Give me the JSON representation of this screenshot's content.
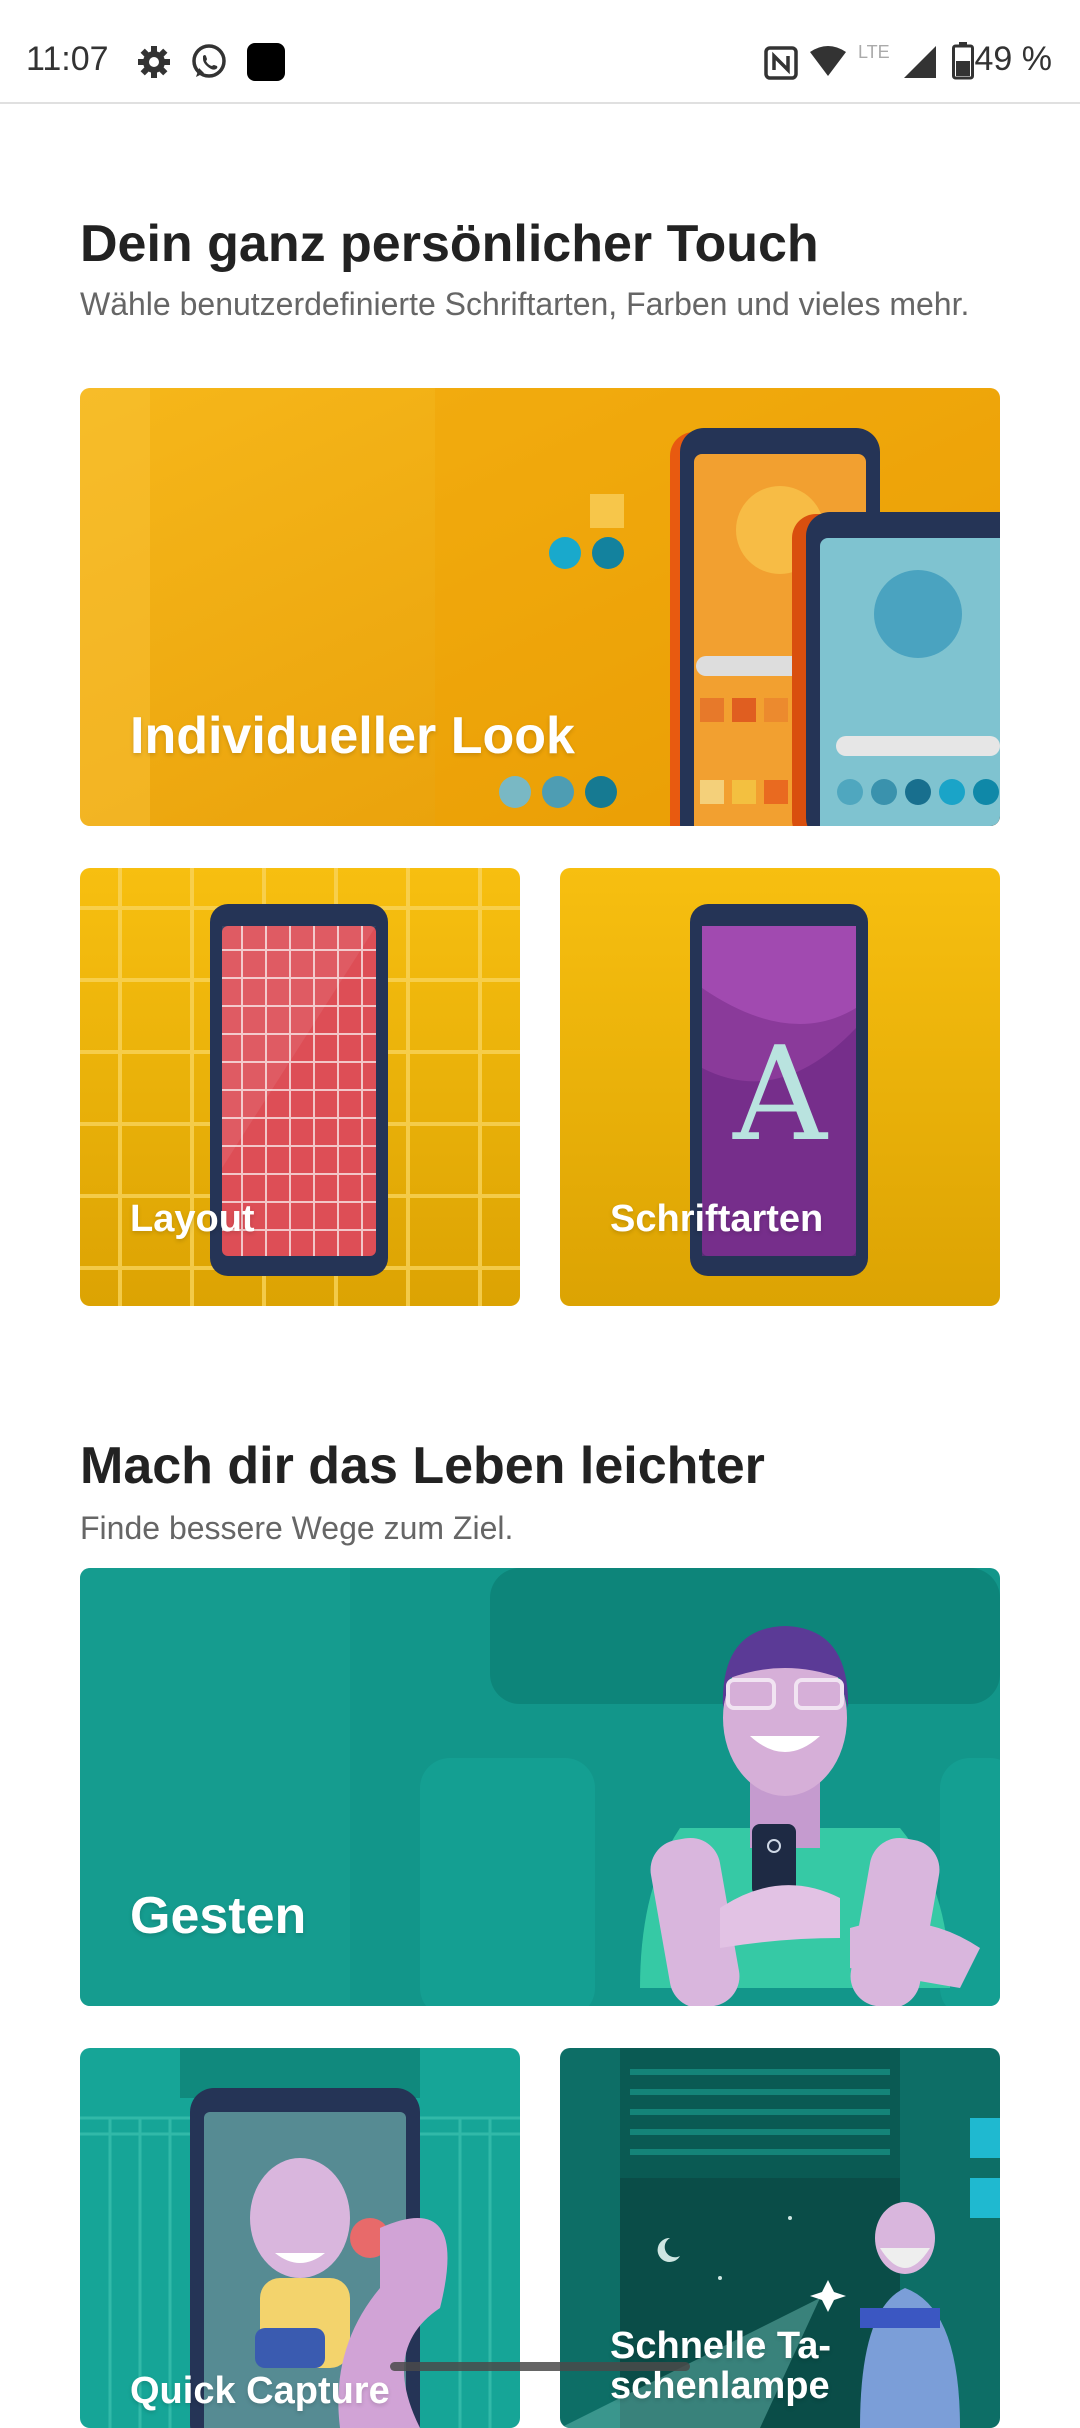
{
  "status_bar": {
    "time": "11:07",
    "network_label": "LTE",
    "battery": "49 %"
  },
  "section1": {
    "title": "Dein ganz persönlicher Touch",
    "subtitle": "Wähle benutzerdefinierte Schriftarten, Farben und vieles mehr.",
    "cards": {
      "individual_look": "Individueller Look",
      "layout": "Layout",
      "fonts": "Schriftarten",
      "fonts_glyph": "A"
    }
  },
  "section2": {
    "title": "Mach dir das Leben leichter",
    "subtitle": "Finde bessere Wege zum Ziel.",
    "cards": {
      "gestures": "Gesten",
      "quick_capture": "Quick Capture",
      "flashlight": "Schnelle Ta-\nschenlampe"
    }
  },
  "colors": {
    "yellow_card": "#f4b400",
    "teal_card": "#12968a",
    "dark_teal_card": "#0d6e66"
  }
}
